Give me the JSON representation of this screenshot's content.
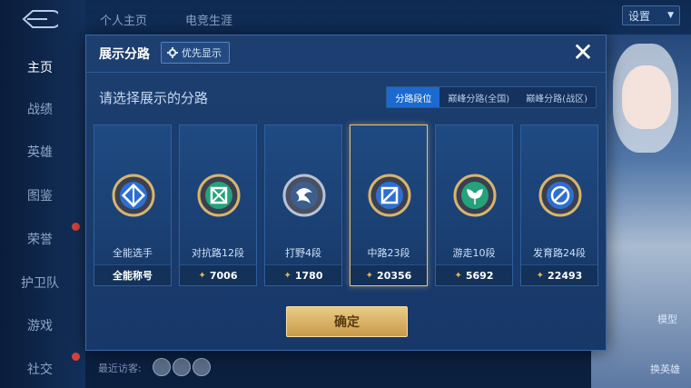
{
  "nav": {
    "items": [
      {
        "label": "主页",
        "active": true
      },
      {
        "label": "战绩"
      },
      {
        "label": "英雄"
      },
      {
        "label": "图鉴"
      },
      {
        "label": "荣誉"
      },
      {
        "label": "护卫队"
      },
      {
        "label": "游戏"
      },
      {
        "label": "社交"
      }
    ]
  },
  "top": {
    "tabs": [
      "个人主页",
      "电竞生涯"
    ],
    "settings_label": "设置"
  },
  "modal": {
    "title": "展示分路",
    "priority_label": "优先显示",
    "close_label": "✕",
    "subtitle": "请选择展示的分路",
    "tabs": [
      {
        "label": "分路段位",
        "active": true
      },
      {
        "label": "巅峰分路(全国)"
      },
      {
        "label": "巅峰分路(战区)"
      }
    ],
    "cards": [
      {
        "name": "全能选手",
        "footer": "全能称号",
        "icon": "all-round-badge-icon",
        "selected": false
      },
      {
        "name": "对抗路12段",
        "footer": "7006",
        "icon": "clash-lane-badge-icon",
        "selected": false
      },
      {
        "name": "打野4段",
        "footer": "1780",
        "icon": "jungle-badge-icon",
        "selected": false
      },
      {
        "name": "中路23段",
        "footer": "20356",
        "icon": "mid-lane-badge-icon",
        "selected": true
      },
      {
        "name": "游走10段",
        "footer": "5692",
        "icon": "roam-badge-icon",
        "selected": false
      },
      {
        "name": "发育路24段",
        "footer": "22493",
        "icon": "farm-lane-badge-icon",
        "selected": false
      }
    ],
    "confirm_label": "确定"
  },
  "side": {
    "model_label": "模型",
    "change_hero_label": "换英雄"
  },
  "footer": {
    "visitor_label": "最近访客:"
  },
  "colors": {
    "accent_blue": "#1b6ad0",
    "gold": "#e7c277",
    "panel": "#1c3f70"
  }
}
